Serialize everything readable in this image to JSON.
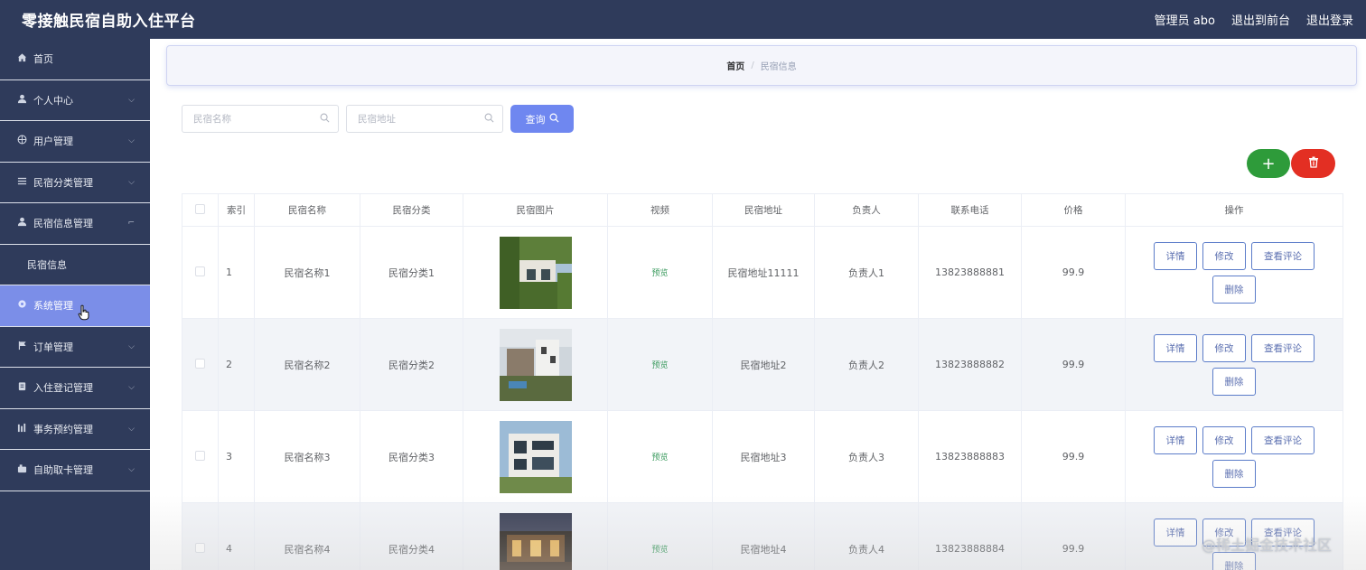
{
  "header": {
    "title": "零接触民宿自助入住平台",
    "admin_label": "管理员 abo",
    "front_label": "退出到前台",
    "logout_label": "退出登录"
  },
  "sidebar": {
    "items": [
      {
        "label": "首页",
        "icon": "home-icon",
        "expandable": false
      },
      {
        "label": "个人中心",
        "icon": "user-icon",
        "expandable": true
      },
      {
        "label": "用户管理",
        "icon": "users-circle-icon",
        "expandable": true
      },
      {
        "label": "民宿分类管理",
        "icon": "list-icon",
        "expandable": true
      },
      {
        "label": "民宿信息管理",
        "icon": "user-icon",
        "expandable": true
      },
      {
        "label": "民宿信息",
        "sub": true
      },
      {
        "label": "系统管理",
        "icon": "gear-icon",
        "expandable": false,
        "active": true
      },
      {
        "label": "订单管理",
        "icon": "flag-icon",
        "expandable": true
      },
      {
        "label": "入住登记管理",
        "icon": "clipboard-icon",
        "expandable": true
      },
      {
        "label": "事务预约管理",
        "icon": "chart-icon",
        "expandable": true
      },
      {
        "label": "自助取卡管理",
        "icon": "card-icon",
        "expandable": true
      }
    ]
  },
  "breadcrumb": {
    "home": "首页",
    "separator": "/",
    "current": "民宿信息"
  },
  "search": {
    "name_placeholder": "民宿名称",
    "address_placeholder": "民宿地址",
    "query_label": "查询"
  },
  "actions": {
    "add_symbol": "+",
    "delete_icon": "trash-icon"
  },
  "table": {
    "columns": [
      "索引",
      "民宿名称",
      "民宿分类",
      "民宿图片",
      "视频",
      "民宿地址",
      "负责人",
      "联系电话",
      "价格",
      "操作"
    ],
    "rows": [
      {
        "index": "1",
        "name": "民宿名称1",
        "category": "民宿分类1",
        "video": "预览",
        "address": "民宿地址11111",
        "manager": "负责人1",
        "phone": "13823888881",
        "price": "99.9"
      },
      {
        "index": "2",
        "name": "民宿名称2",
        "category": "民宿分类2",
        "video": "预览",
        "address": "民宿地址2",
        "manager": "负责人2",
        "phone": "13823888882",
        "price": "99.9"
      },
      {
        "index": "3",
        "name": "民宿名称3",
        "category": "民宿分类3",
        "video": "预览",
        "address": "民宿地址3",
        "manager": "负责人3",
        "phone": "13823888883",
        "price": "99.9"
      },
      {
        "index": "4",
        "name": "民宿名称4",
        "category": "民宿分类4",
        "video": "预览",
        "address": "民宿地址4",
        "manager": "负责人4",
        "phone": "13823888884",
        "price": "99.9"
      }
    ],
    "row_actions": {
      "detail": "详情",
      "edit": "修改",
      "comments": "查看评论",
      "delete": "删除"
    }
  },
  "watermark": "@稀土掘金技术社区"
}
